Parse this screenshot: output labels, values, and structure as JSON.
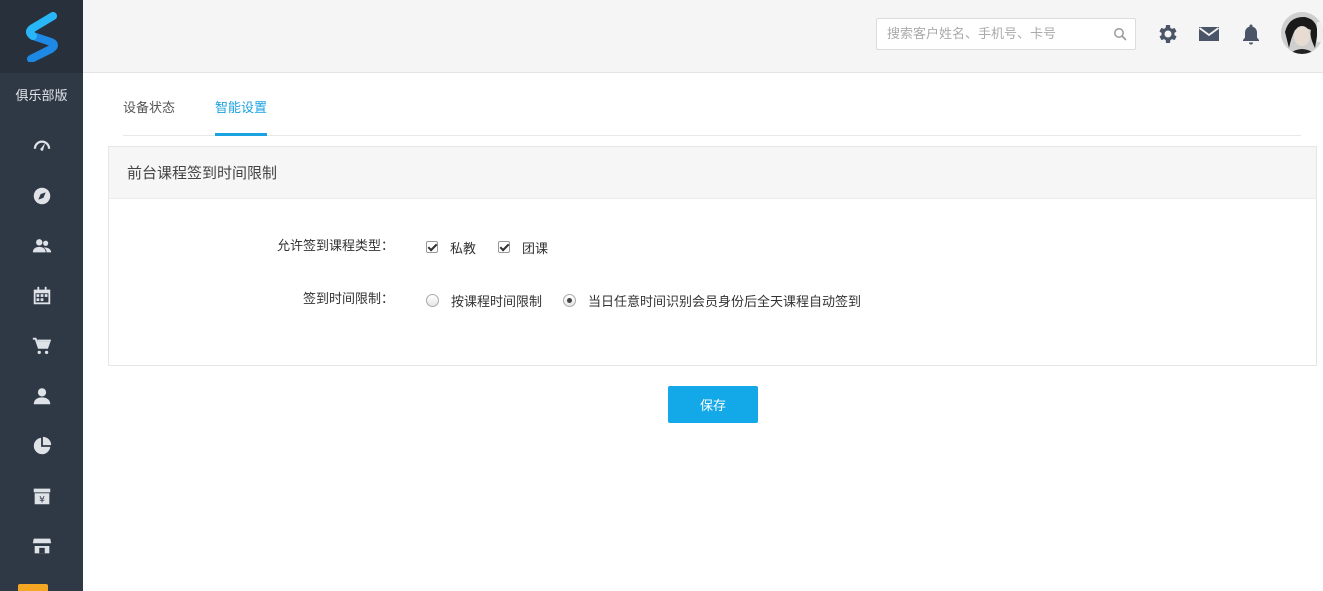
{
  "sidebar": {
    "brand_label": "俱乐部版",
    "items": [
      {
        "icon": "dashboard-gauge-icon"
      },
      {
        "icon": "compass-icon"
      },
      {
        "icon": "members-icon"
      },
      {
        "icon": "calendar-icon"
      },
      {
        "icon": "cart-icon"
      },
      {
        "icon": "user-icon"
      },
      {
        "icon": "pie-chart-icon"
      },
      {
        "icon": "finance-yen-icon"
      },
      {
        "icon": "store-icon"
      }
    ]
  },
  "header": {
    "search_placeholder": "搜索客户姓名、手机号、卡号",
    "icons": [
      "settings-gear-icon",
      "mail-icon",
      "bell-icon"
    ]
  },
  "tabs": [
    {
      "label": "设备状态",
      "active": false
    },
    {
      "label": "智能设置",
      "active": true
    }
  ],
  "panel": {
    "title": "前台课程签到时间限制",
    "course_type": {
      "label": "允许签到课程类型：",
      "options": [
        {
          "label": "私教",
          "checked": true
        },
        {
          "label": "团课",
          "checked": true
        }
      ]
    },
    "time_limit": {
      "label": "签到时间限制：",
      "options": [
        {
          "label": "按课程时间限制",
          "selected": false
        },
        {
          "label": "当日任意时间识别会员身份后全天课程自动签到",
          "selected": true
        }
      ]
    }
  },
  "save_label": "保存",
  "colors": {
    "sidebar_bg": "#2f3845",
    "accent": "#1ba2e0",
    "button": "#13a8e7"
  }
}
